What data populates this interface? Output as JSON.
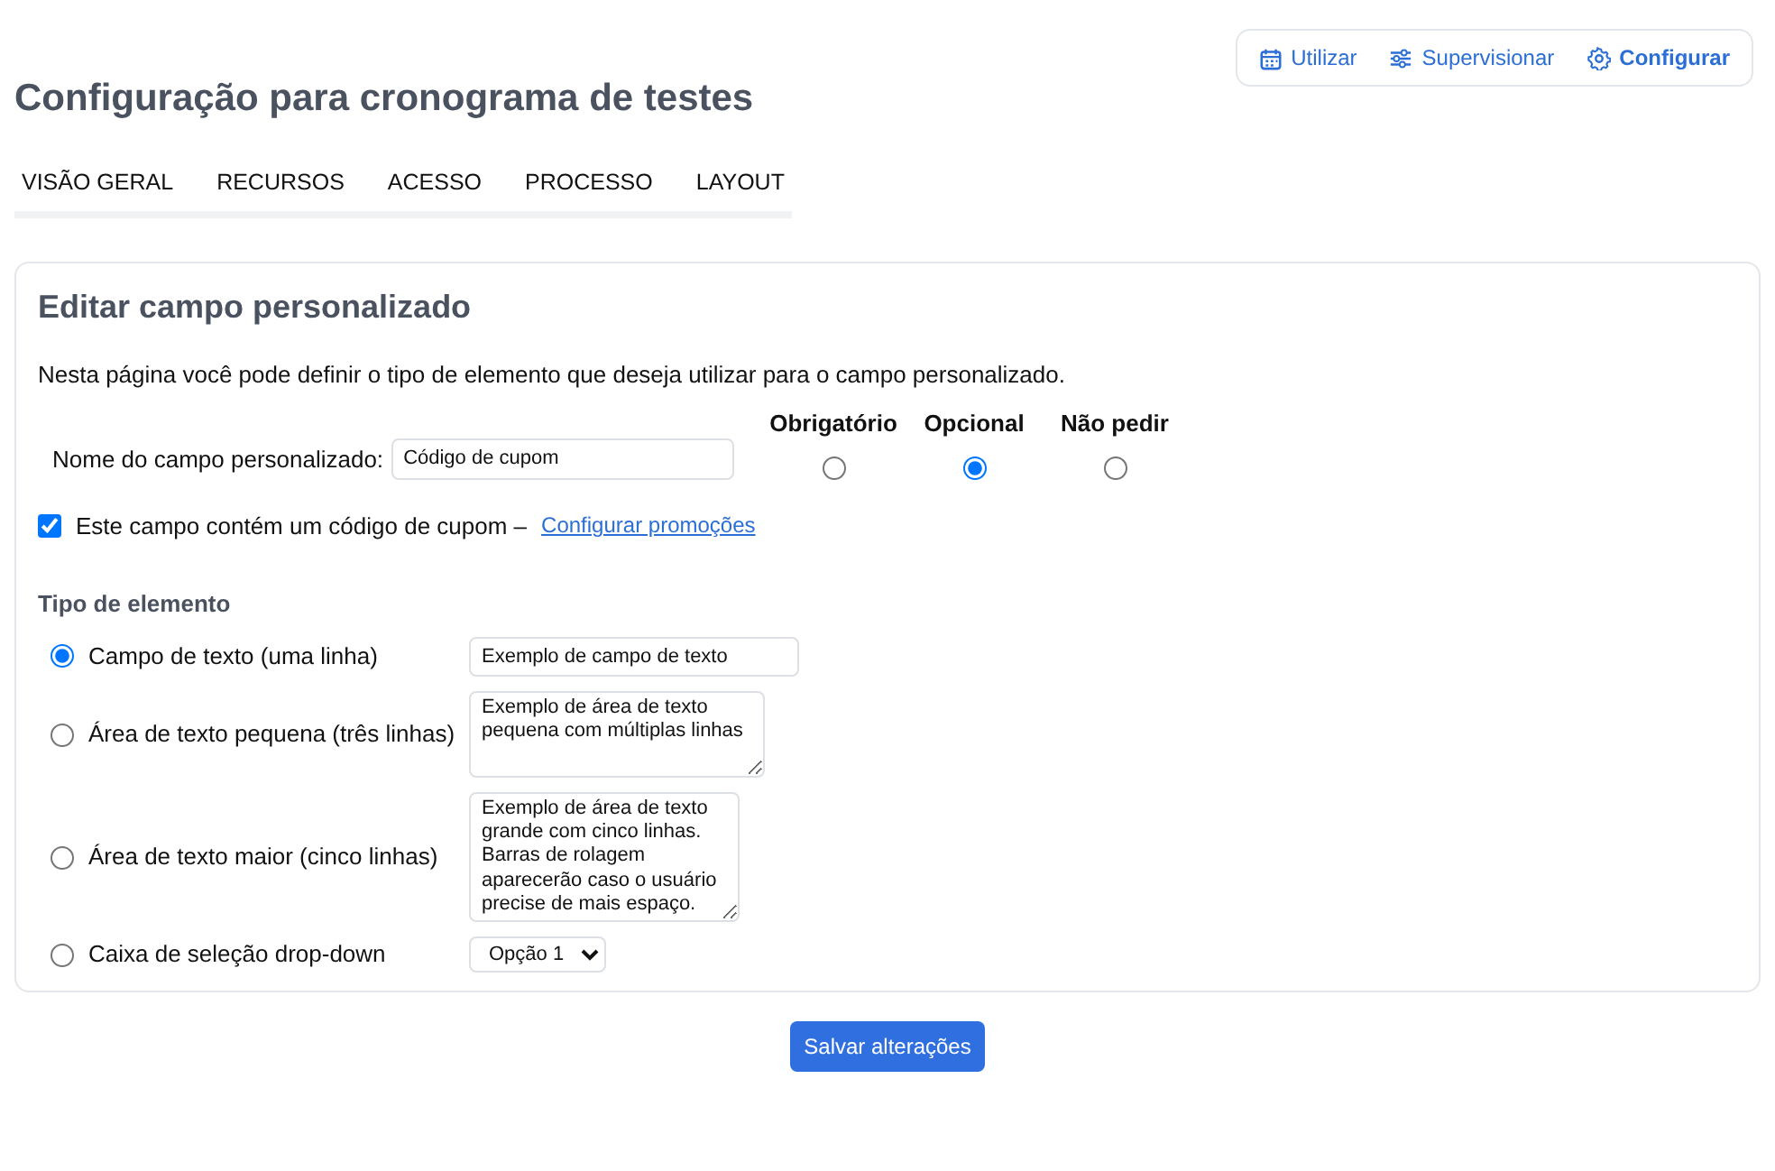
{
  "top_nav": [
    {
      "label": "Utilizar",
      "selected": false
    },
    {
      "label": "Supervisionar",
      "selected": false
    },
    {
      "label": "Configurar",
      "selected": true
    }
  ],
  "page_title": "Configuração para cronograma de testes",
  "tabs": [
    {
      "label": "VISÃO GERAL"
    },
    {
      "label": "RECURSOS"
    },
    {
      "label": "ACESSO"
    },
    {
      "label": "PROCESSO"
    },
    {
      "label": "LAYOUT"
    }
  ],
  "card": {
    "title": "Editar campo personalizado",
    "intro": "Nesta página você pode definir o tipo de elemento que deseja utilizar para o campo personalizado.",
    "name_label": "Nome do campo personalizado:",
    "name_value": "Código de cupom",
    "requirement_options": [
      {
        "label": "Obrigatório",
        "selected": false
      },
      {
        "label": "Opcional",
        "selected": true
      },
      {
        "label": "Não pedir",
        "selected": false
      }
    ],
    "coupon": {
      "label": "Este campo contém um código de cupom –",
      "checked": true,
      "link": "Configurar promoções"
    },
    "element_type_heading": "Tipo de elemento",
    "element_types": [
      {
        "label": "Campo de texto (uma linha)",
        "selected": true,
        "kind": "input",
        "sample": "Exemplo de campo de texto"
      },
      {
        "label": "Área de texto pequena (três linhas)",
        "selected": false,
        "kind": "textarea-small",
        "sample": "Exemplo de área de texto pequena com múltiplas linhas"
      },
      {
        "label": "Área de texto maior (cinco linhas)",
        "selected": false,
        "kind": "textarea-large",
        "sample": "Exemplo de área de texto grande com cinco linhas. Barras de rolagem aparecerão caso o usuário precise de mais espaço."
      },
      {
        "label": "Caixa de seleção drop-down",
        "selected": false,
        "kind": "select",
        "sample": "Opção 1"
      }
    ]
  },
  "save_button": "Salvar alterações"
}
